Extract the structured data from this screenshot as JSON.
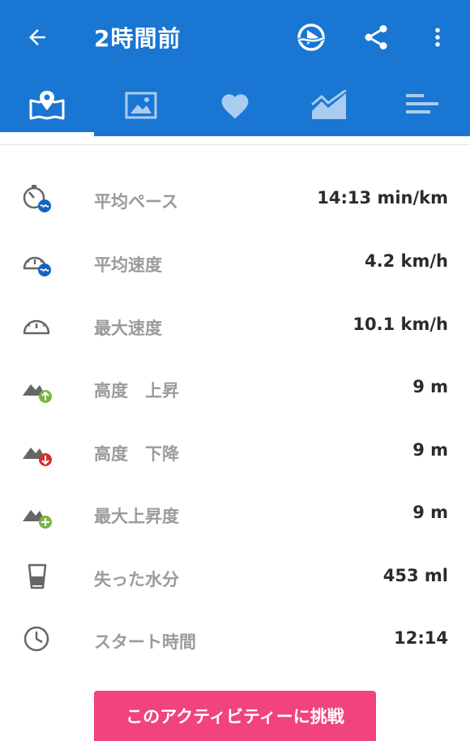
{
  "header": {
    "title": "2時間前"
  },
  "colors": {
    "primary": "#1976d2",
    "accent": "#f1437f",
    "label": "#9b9b9b",
    "value": "#2b2b2b"
  },
  "actions": [
    {
      "icon": "play-route-icon"
    },
    {
      "icon": "share-icon"
    },
    {
      "icon": "more-vert-icon"
    }
  ],
  "tabs": [
    {
      "icon": "map-tab-icon",
      "active": true
    },
    {
      "icon": "photo-tab-icon",
      "active": false
    },
    {
      "icon": "heart-tab-icon",
      "active": false
    },
    {
      "icon": "chart-tab-icon",
      "active": false
    },
    {
      "icon": "laps-tab-icon",
      "active": false
    }
  ],
  "stats": [
    {
      "icon": "pace-icon",
      "label": "平均ペース",
      "value": "14:13 min/km"
    },
    {
      "icon": "avg-speed-icon",
      "label": "平均速度",
      "value": "4.2 km/h"
    },
    {
      "icon": "max-speed-icon",
      "label": "最大速度",
      "value": "10.1 km/h"
    },
    {
      "icon": "elevation-gain-icon",
      "label": "高度　上昇",
      "value": "9 m"
    },
    {
      "icon": "elevation-loss-icon",
      "label": "高度　下降",
      "value": "9 m"
    },
    {
      "icon": "max-elevation-icon",
      "label": "最大上昇度",
      "value": "9 m"
    },
    {
      "icon": "water-loss-icon",
      "label": "失った水分",
      "value": "453 ml"
    },
    {
      "icon": "start-time-icon",
      "label": "スタート時間",
      "value": "12:14"
    }
  ],
  "cta": {
    "label": "このアクティビティーに挑戦"
  }
}
